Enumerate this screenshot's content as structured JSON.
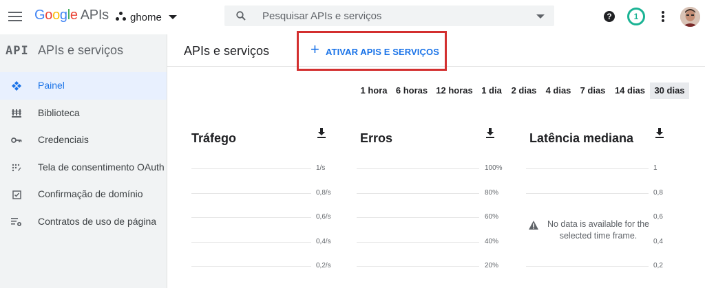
{
  "header": {
    "logo_google": "Google",
    "logo_apis": "APIs",
    "project_name": "ghome",
    "search_placeholder": "Pesquisar APIs e serviços",
    "help_label": "?",
    "notification_count": "1"
  },
  "sidebar": {
    "logo": "API",
    "title": "APIs e serviços",
    "items": [
      {
        "label": "Painel",
        "icon": "dashboard-icon",
        "active": true
      },
      {
        "label": "Biblioteca",
        "icon": "library-icon",
        "active": false
      },
      {
        "label": "Credenciais",
        "icon": "key-icon",
        "active": false
      },
      {
        "label": "Tela de consentimento OAuth",
        "icon": "consent-screen-icon",
        "active": false
      },
      {
        "label": "Confirmação de domínio",
        "icon": "checkbox-icon",
        "active": false
      },
      {
        "label": "Contratos de uso de página",
        "icon": "settings-list-icon",
        "active": false
      }
    ]
  },
  "main": {
    "title": "APIs e serviços",
    "enable_button": "ATIVAR APIS E SERVIÇOS",
    "time_ranges": [
      "1 hora",
      "6 horas",
      "12 horas",
      "1 dia",
      "2 dias",
      "4 dias",
      "7 dias",
      "14 dias",
      "30 dias"
    ],
    "selected_range": "30 dias",
    "charts": [
      {
        "title": "Tráfego",
        "ticks": [
          "1/s",
          "0,8/s",
          "0,6/s",
          "0,4/s",
          "0,2/s"
        ]
      },
      {
        "title": "Erros",
        "ticks": [
          "100%",
          "80%",
          "60%",
          "40%",
          "20%"
        ]
      },
      {
        "title": "Latência mediana",
        "ticks": [
          "1",
          "0,8",
          "0,6",
          "0,4",
          "0,2"
        ],
        "no_data": "No data is available for the selected time frame."
      }
    ]
  },
  "colors": {
    "accent": "#1a73e8",
    "highlight_border": "#d32f2f",
    "notification": "#1ab394",
    "sidebar_bg": "#f1f3f4"
  }
}
